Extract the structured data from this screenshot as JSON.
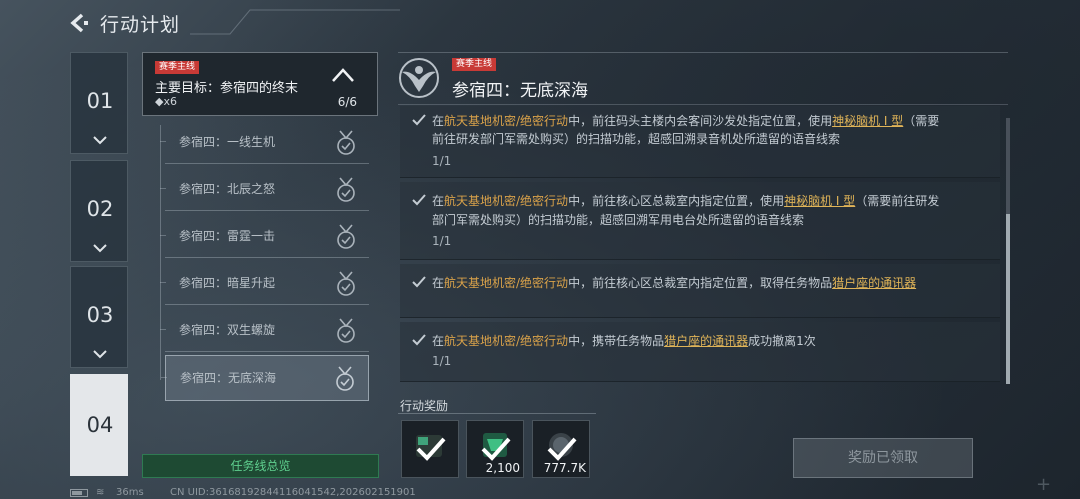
{
  "header": {
    "title": "行动计划",
    "back_icon": "back-arrow-icon"
  },
  "chapters": [
    {
      "label": "01",
      "state": "collapsed"
    },
    {
      "label": "02",
      "state": "collapsed"
    },
    {
      "label": "03",
      "state": "collapsed"
    },
    {
      "label": "04",
      "state": "selected"
    }
  ],
  "main_target": {
    "tag": "赛季主线",
    "title": "主要目标：参宿四的终末",
    "reward": "◆x6",
    "progress": "6/6"
  },
  "subtasks": [
    {
      "label": "参宿四：一线生机",
      "completed": true
    },
    {
      "label": "参宿四：北辰之怒",
      "completed": true
    },
    {
      "label": "参宿四：雷霆一击",
      "completed": true
    },
    {
      "label": "参宿四：暗星升起",
      "completed": true
    },
    {
      "label": "参宿四：双生螺旋",
      "completed": true
    },
    {
      "label": "参宿四：无底深海",
      "completed": true,
      "selected": true
    }
  ],
  "overview_button": "任务线总览",
  "detail": {
    "tag": "赛季主线",
    "title": "参宿四：无底深海",
    "objectives": [
      {
        "line1": {
          "prefix": "在",
          "hl": "航天基地机密/绝密行动",
          "mid": "中，前往码头主楼内会客间沙发处指定位置，使用",
          "link": "神秘脑机 I 型",
          "suffix": "（需要"
        },
        "line2": "前往研发部门军需处购买）的扫描功能，超感回溯录音机处所遗留的语音线索",
        "count": "1/1"
      },
      {
        "line1": {
          "prefix": "在",
          "hl": "航天基地机密/绝密行动",
          "mid": "中，前往核心区总裁室内指定位置，使用",
          "link": "神秘脑机 I 型",
          "suffix": "（需要前往研发"
        },
        "line2": "部门军需处购买）的扫描功能，超感回溯军用电台处所遗留的语音线索",
        "count": "1/1"
      },
      {
        "line1": {
          "prefix": "在",
          "hl": "航天基地机密/绝密行动",
          "mid": "中，前往核心区总裁室内指定位置，取得任务物品",
          "link": "猎户座的通讯器",
          "suffix": ""
        },
        "line2": "",
        "count": ""
      },
      {
        "line1": {
          "prefix": "在",
          "hl": "航天基地机密/绝密行动",
          "mid": "中，携带任务物品",
          "link": "猎户座的通讯器",
          "suffix": "成功撤离1次"
        },
        "line2": "",
        "count": "1/1"
      }
    ]
  },
  "rewards": {
    "label": "行动奖励",
    "items": [
      {
        "icon": "checkmark-icon",
        "qty": ""
      },
      {
        "icon": "gem-icon",
        "qty": "2,100"
      },
      {
        "icon": "coin-icon",
        "qty": "777.7K"
      }
    ],
    "claimed_button": "奖励已领取"
  },
  "status_bar": {
    "ping": "36ms",
    "uid": "CN UID:3616819284411604154​2,202602151901"
  }
}
